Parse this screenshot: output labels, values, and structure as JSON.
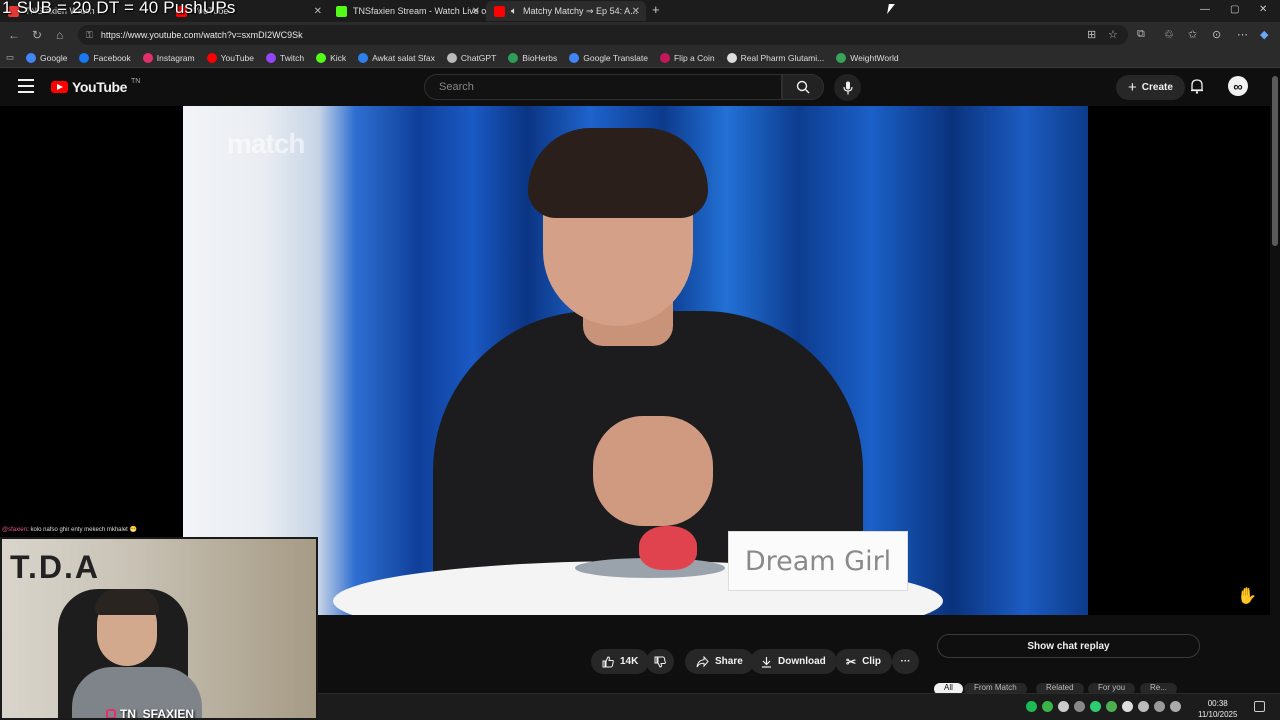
{
  "overlay": {
    "text": "1 SUB = 20 DT = 40 PushUPs"
  },
  "tabs": [
    {
      "title": "TNSfaxien Watch ...",
      "color": "#e53935"
    },
    {
      "title": "YouTube",
      "color": "#ff0000"
    },
    {
      "title": "TNSfaxien Stream - Watch Live on ...",
      "color": "#53fc18"
    },
    {
      "title": "Matchy Matchy ⇒ Ep 54: A...",
      "color": "#ff0000"
    }
  ],
  "address": {
    "url": "https://www.youtube.com/watch?v=sxmDI2WC9Sk"
  },
  "bookmarks": [
    {
      "label": "Google",
      "color": "#4285f4"
    },
    {
      "label": "Facebook",
      "color": "#1877f2"
    },
    {
      "label": "Instagram",
      "color": "#e1306c"
    },
    {
      "label": "YouTube",
      "color": "#ff0000"
    },
    {
      "label": "Twitch",
      "color": "#9146ff"
    },
    {
      "label": "Kick",
      "color": "#53fc18"
    },
    {
      "label": "Awkat salat Sfax",
      "color": "#2f80ed"
    },
    {
      "label": "ChatGPT",
      "color": "#bbbbbb"
    },
    {
      "label": "BioHerbs",
      "color": "#2e9d57"
    },
    {
      "label": "Google Translate",
      "color": "#4285f4"
    },
    {
      "label": "Flip a Coin",
      "color": "#c2185b"
    },
    {
      "label": "Real Pharm Glutami...",
      "color": "#dddddd"
    },
    {
      "label": "WeightWorld",
      "color": "#3aa35a"
    }
  ],
  "masthead": {
    "logo_text": "YouTube",
    "country_code": "TN",
    "search_placeholder": "Search",
    "create_label": "Create",
    "avatar_glyph": "∞"
  },
  "video": {
    "watermark": "match",
    "nameplate": "Dream Girl"
  },
  "webcam": {
    "chat_user": "@sfaxien",
    "chat_message": ": kolo nafso ghir enty mekech mkhalet 😁",
    "sign_text": "T.D.A",
    "tag": "TN_SFAXIEN"
  },
  "actions": {
    "like_count": "14K",
    "share_label": "Share",
    "download_label": "Download",
    "clip_label": "Clip",
    "more_label": "···",
    "show_chat_label": "Show chat replay"
  },
  "chips": [
    "All",
    "From Match",
    "Related",
    "For you",
    "Re..."
  ],
  "taskbar": {
    "time": "00:38",
    "date": "11/10/2025"
  }
}
